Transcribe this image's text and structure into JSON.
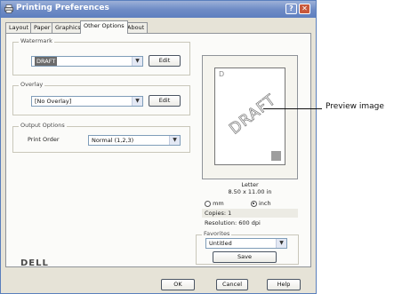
{
  "window": {
    "title": "Printing Preferences",
    "help_label": "?",
    "close_label": "✕"
  },
  "tabs": [
    {
      "label": "Layout"
    },
    {
      "label": "Paper"
    },
    {
      "label": "Graphics"
    },
    {
      "label": "Other Options",
      "active": true
    },
    {
      "label": "About"
    }
  ],
  "watermark": {
    "group_label": "Watermark",
    "value": "DRAFT",
    "edit_label": "Edit"
  },
  "overlay": {
    "group_label": "Overlay",
    "value": "[No Overlay]",
    "edit_label": "Edit"
  },
  "output_options": {
    "group_label": "Output Options",
    "print_order_label": "Print Order",
    "print_order_value": "Normal (1,2,3)"
  },
  "preview": {
    "page_letter": "D",
    "watermark_text": "DRAFT",
    "paper_name": "Letter",
    "paper_size": "8.50 x 11.00 in",
    "unit_mm": "mm",
    "unit_inch": "inch",
    "selected_unit": "inch",
    "copies": "Copies: 1",
    "resolution": "Resolution: 600 dpi"
  },
  "favorites": {
    "group_label": "Favorites",
    "value": "Untitled",
    "save_label": "Save"
  },
  "brand": "DELL",
  "footer": {
    "ok_label": "OK",
    "cancel_label": "Cancel",
    "help_label": "Help"
  },
  "callout": "Preview image"
}
